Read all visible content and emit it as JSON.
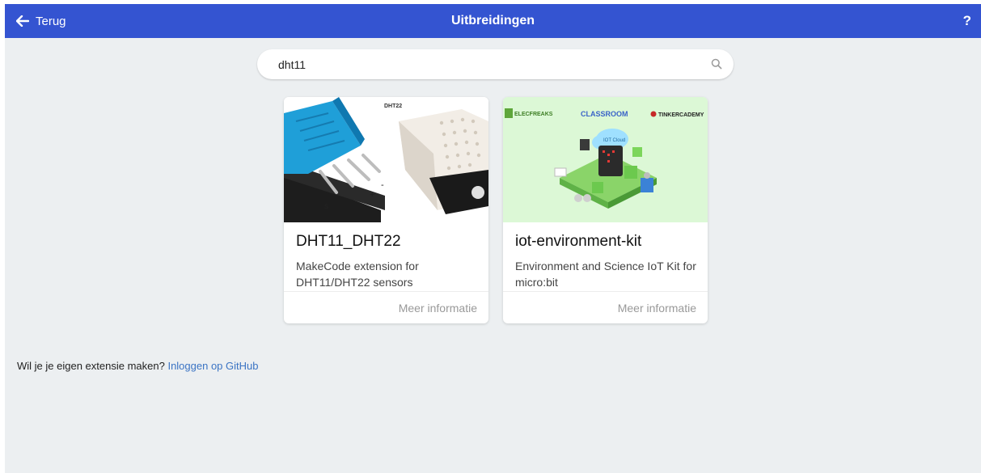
{
  "header": {
    "back_label": "Terug",
    "title": "Uitbreidingen",
    "help_label": "?"
  },
  "search": {
    "value": "dht11"
  },
  "cards": [
    {
      "name": "DHT11_DHT22",
      "description": "MakeCode extension for DHT11/DHT22 sensors",
      "image_label": "DHT22",
      "more_label": "Meer informatie"
    },
    {
      "name": "iot-environment-kit",
      "description": "Environment and Science IoT Kit for micro:bit",
      "image_brands": [
        "ELECFREAKS",
        "CLASSROOM",
        "TINKERCADEMY"
      ],
      "image_cloud_label": "IOT Cloud",
      "more_label": "Meer informatie"
    }
  ],
  "footer": {
    "question": "Wil je je eigen extensie maken?",
    "link": "Inloggen op GitHub"
  },
  "colors": {
    "header": "#3454d1",
    "background": "#eceff1",
    "link": "#3b74c4"
  }
}
